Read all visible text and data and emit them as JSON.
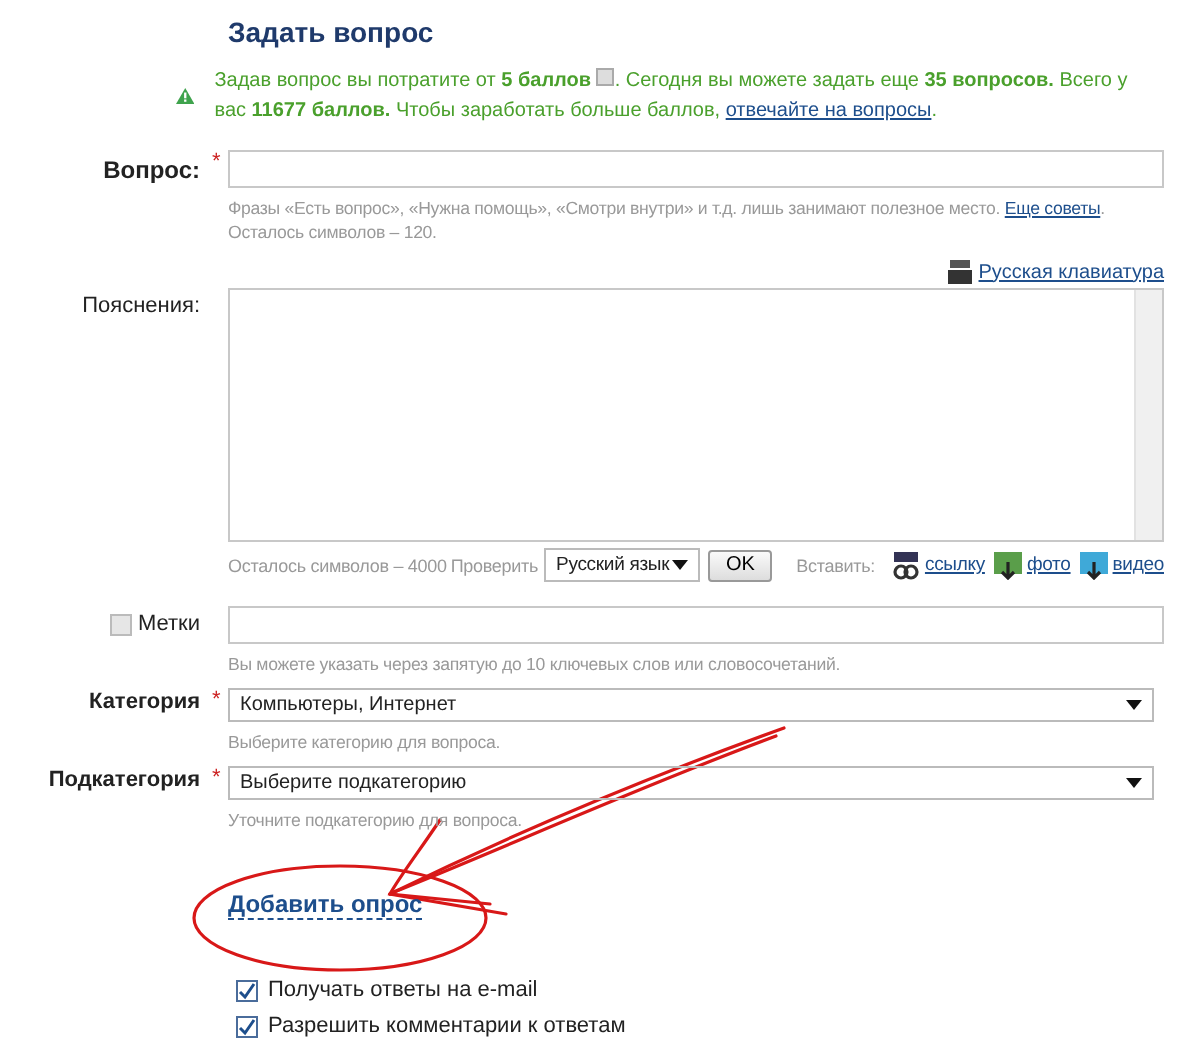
{
  "title": "Задать вопрос",
  "notice": {
    "lead": "Задав вопрос вы потратите от **5 баллов**",
    "rest": ". Сегодня вы можете задать еще **35 вопросов.** Всего у вас **11677 баллов.** Чтобы заработать больше баллов, ",
    "link": "отвечайте на вопросы",
    "end": "."
  },
  "question": {
    "label": "Вопрос:",
    "marker": "*",
    "hint": "Фразы «Есть вопрос», «Нужна помощь», «Смотри внутри» и т.д. лишь занимают полезное место. ",
    "hint_link": "Еще советы",
    "hint_end": ".",
    "counter": "Осталось символов – 120."
  },
  "keyboard_link": "Русская клавиатура",
  "details": {
    "label": "Пояснения:",
    "counter": "Осталось символов – 4000",
    "spell_label": "Проверить",
    "language": "Русский язык",
    "ok": "OK",
    "insert_label": "Вставить:",
    "insert": [
      {
        "kind": "link",
        "label": "ссылку"
      },
      {
        "kind": "photo",
        "label": "фото"
      },
      {
        "kind": "video",
        "label": "видео"
      }
    ]
  },
  "tags": {
    "label": "Метки",
    "checked": false,
    "hint": "Вы можете указать через запятую до 10 ключевых слов или словосочетаний."
  },
  "selects": [
    {
      "label": "Категория",
      "marker": "*",
      "value": "Компьютеры, Интернет",
      "hint": "Выберите категорию для вопроса."
    },
    {
      "label": "Подкатегория",
      "marker": "*",
      "value": "Выберите подкатегорию",
      "hint": "Уточните подкатегорию для вопроса."
    }
  ],
  "add_poll": "Добавить опрос",
  "options": [
    {
      "label": "Получать ответы на e-mail",
      "checked": true
    },
    {
      "label": "Разрешить комментарии к ответам",
      "checked": true
    }
  ]
}
